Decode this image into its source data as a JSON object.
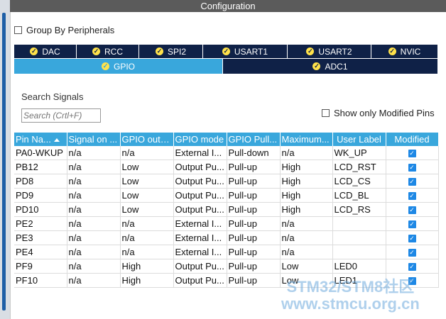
{
  "window": {
    "title": "Configuration"
  },
  "options": {
    "group_by_peripherals": "Group By Peripherals",
    "search_signals_label": "Search Signals",
    "search_placeholder": "Search (Crtl+F)",
    "show_only_modified": "Show only Modified Pins"
  },
  "tabs_row1": [
    "DAC",
    "RCC",
    "SPI2",
    "USART1",
    "USART2",
    "NVIC"
  ],
  "tabs_row2": [
    "GPIO",
    "ADC1"
  ],
  "active_tab": "GPIO",
  "table": {
    "headers": [
      "Pin Na...",
      "Signal on ...",
      "GPIO outp...",
      "GPIO mode",
      "GPIO Pull...",
      "Maximum...",
      "User Label",
      "Modified"
    ],
    "rows": [
      [
        "PA0-WKUP",
        "n/a",
        "n/a",
        "External I...",
        "Pull-down",
        "n/a",
        "WK_UP",
        "checked"
      ],
      [
        "PB12",
        "n/a",
        "Low",
        "Output Pu...",
        "Pull-up",
        "High",
        "LCD_RST",
        "checked"
      ],
      [
        "PD8",
        "n/a",
        "Low",
        "Output Pu...",
        "Pull-up",
        "High",
        "LCD_CS",
        "checked"
      ],
      [
        "PD9",
        "n/a",
        "Low",
        "Output Pu...",
        "Pull-up",
        "High",
        "LCD_BL",
        "checked"
      ],
      [
        "PD10",
        "n/a",
        "Low",
        "Output Pu...",
        "Pull-up",
        "High",
        "LCD_RS",
        "checked"
      ],
      [
        "PE2",
        "n/a",
        "n/a",
        "External I...",
        "Pull-up",
        "n/a",
        "",
        "checked"
      ],
      [
        "PE3",
        "n/a",
        "n/a",
        "External I...",
        "Pull-up",
        "n/a",
        "",
        "checked"
      ],
      [
        "PE4",
        "n/a",
        "n/a",
        "External I...",
        "Pull-up",
        "n/a",
        "",
        "checked"
      ],
      [
        "PF9",
        "n/a",
        "High",
        "Output Pu...",
        "Pull-up",
        "Low",
        "LED0",
        "checked"
      ],
      [
        "PF10",
        "n/a",
        "High",
        "Output Pu...",
        "Pull-up",
        "Low",
        "LED1",
        "checked"
      ]
    ]
  },
  "watermark": {
    "line1": "STM32/STM8社区",
    "line2": "www.stmcu.org.cn"
  },
  "colors": {
    "accent": "#39a7dc",
    "tab_dark": "#0f2147",
    "title_bar": "#5b5b5b",
    "check_blue": "#1e88e5"
  }
}
